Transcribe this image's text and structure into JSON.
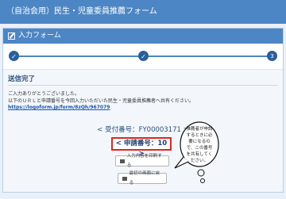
{
  "header": {
    "title": "（自治会用）民生・児童委員推薦フォーム"
  },
  "panel": {
    "title": "入力フォーム"
  },
  "steps": [
    "",
    "",
    "3"
  ],
  "result": {
    "title": "送信完了",
    "message_line1": "ご入力ありがとうございました。",
    "message_line2": "以下のＵＲＬと申請番号を今回入力いただいた民生・児童委員推薦者へ共有ください。",
    "url": "https://logoform.jp/form/8zQh/967079",
    "receipt_label": "< 受付番号：FY00003171 >",
    "application_label": "< 申請番号：10 >"
  },
  "buttons": {
    "print": "入力内容を印刷する",
    "back": "最初の画面に戻る"
  },
  "callout": {
    "text": "推薦者が申請するときに必要になるので、この番号を共有してください。"
  },
  "colors": {
    "header": "#4d86c4",
    "highlight": "#e0261f",
    "step": "#2b5f9a"
  }
}
